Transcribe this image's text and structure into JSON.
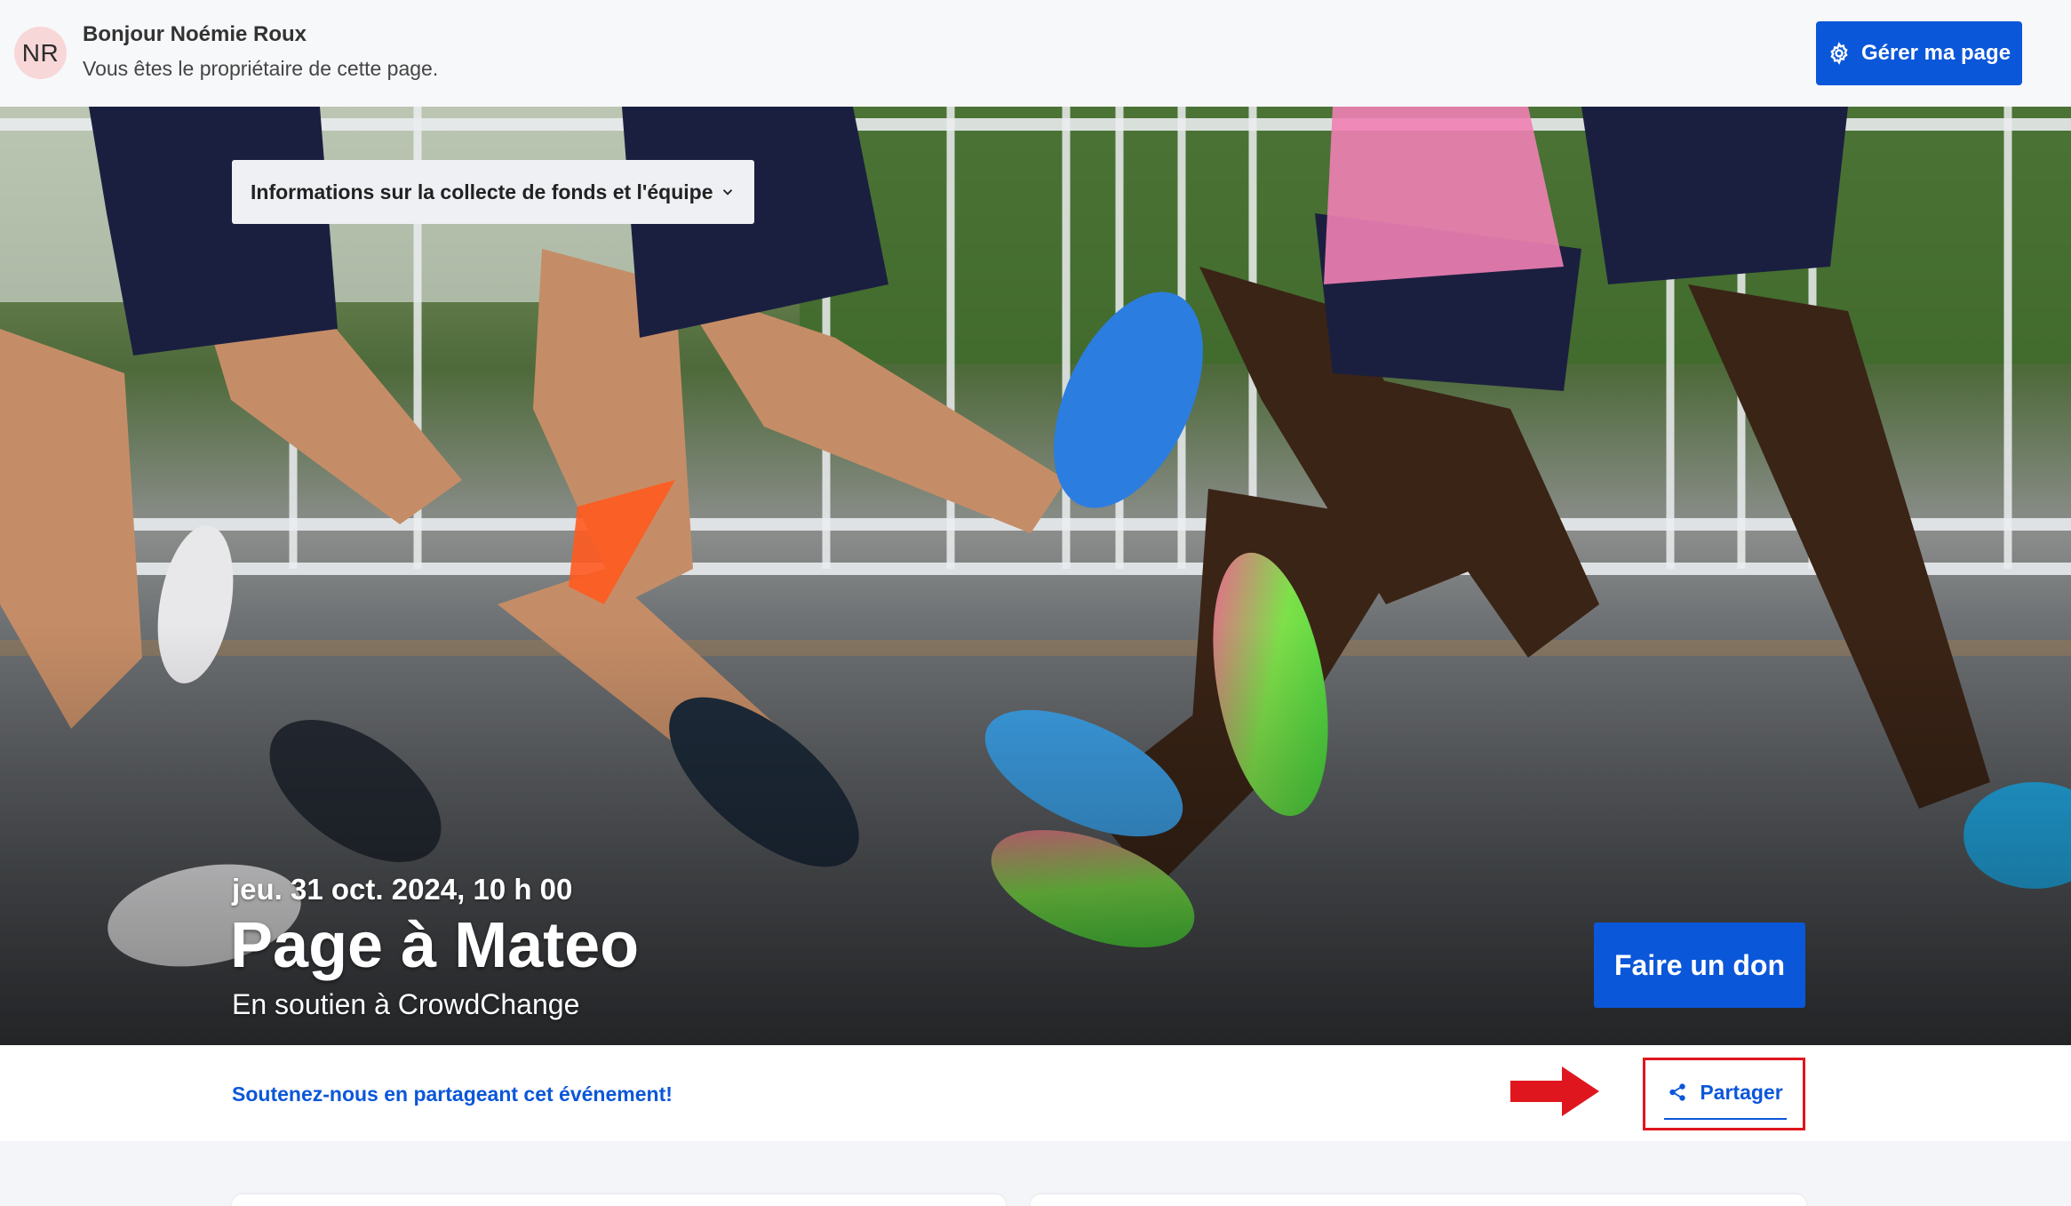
{
  "owner_bar": {
    "avatar_initials": "NR",
    "greeting": "Bonjour Noémie Roux",
    "note": "Vous êtes le propriétaire de cette page.",
    "manage_button": "Gérer ma page",
    "manage_icon": "gear-icon"
  },
  "hero": {
    "dropdown_label": "Informations sur la collecte de fonds et l'équipe",
    "dropdown_icon": "chevron-down-icon",
    "event_date": "jeu. 31 oct. 2024, 10 h 00",
    "title": "Page à Mateo",
    "support_line": "En soutien à CrowdChange",
    "donate_button": "Faire un don"
  },
  "share_bar": {
    "prompt": "Soutenez-nous en partageant cet événement!",
    "share_button": "Partager",
    "share_icon": "share-icon"
  },
  "colors": {
    "primary": "#0b57d9",
    "annotation_red": "#e0161e",
    "avatar_bg": "#f8d7d9"
  }
}
